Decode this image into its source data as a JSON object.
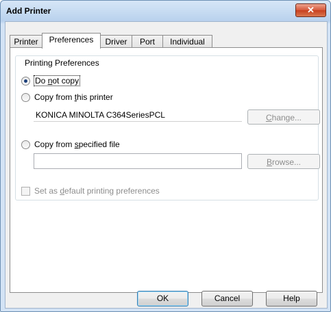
{
  "window": {
    "title": "Add Printer",
    "close_glyph": "✕"
  },
  "tabs": [
    "Printer",
    "Preferences",
    "Driver",
    "Port",
    "Individual"
  ],
  "group": {
    "label": "Printing Preferences"
  },
  "options": {
    "do_not_copy": {
      "pre": "Do ",
      "u": "n",
      "post": "ot copy"
    },
    "copy_from_printer": {
      "pre": "Copy from ",
      "u": "t",
      "post": "his printer"
    },
    "copy_from_file": {
      "pre": "Copy from ",
      "u": "s",
      "post": "pecified file"
    }
  },
  "printer_name": "KONICA MINOLTA C364SeriesPCL",
  "file_path": "",
  "change_button": {
    "u": "C",
    "post": "hange..."
  },
  "browse_button": {
    "u": "B",
    "post": "rowse..."
  },
  "default_checkbox": {
    "pre": "Set as ",
    "u": "d",
    "post": "efault printing preferences"
  },
  "footer": {
    "ok": "OK",
    "cancel": "Cancel",
    "help": "Help"
  },
  "colors": {
    "title_bg": "#c5daf1",
    "close_red": "#c7401f",
    "radio_dot": "#1c3f7a"
  },
  "state": {
    "selected_option": "do_not_copy",
    "set_as_default": false
  }
}
